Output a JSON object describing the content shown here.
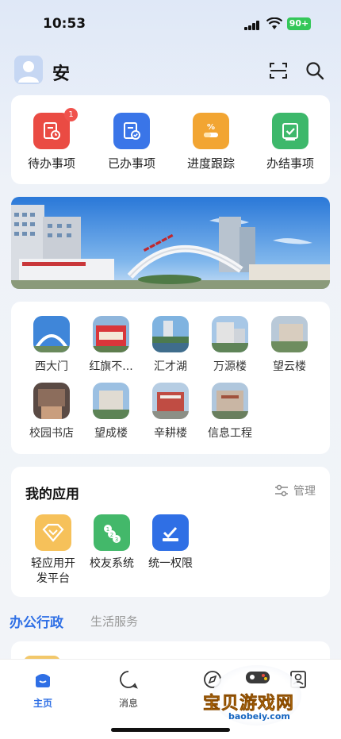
{
  "status_bar": {
    "time": "10:53",
    "battery": "90+"
  },
  "header": {
    "user_name": "安"
  },
  "quick_actions": [
    {
      "label": "待办事项",
      "badge": "1",
      "color": "#ea4b43",
      "icon": "pending-doc-icon"
    },
    {
      "label": "已办事项",
      "color": "#3a75e8",
      "icon": "done-doc-icon"
    },
    {
      "label": "进度跟踪",
      "color": "#f2a532",
      "icon": "progress-icon"
    },
    {
      "label": "办结事项",
      "color": "#3db86b",
      "icon": "finished-check-icon"
    }
  ],
  "places": [
    {
      "label": "西大门"
    },
    {
      "label": "红旗不..."
    },
    {
      "label": "汇才湖"
    },
    {
      "label": "万源楼"
    },
    {
      "label": "望云楼"
    },
    {
      "label": "校园书店"
    },
    {
      "label": "望成楼"
    },
    {
      "label": "辛耕楼"
    },
    {
      "label": "信息工程"
    }
  ],
  "my_apps": {
    "title": "我的应用",
    "manage_label": "管理",
    "apps": [
      {
        "label": "轻应用开发平台",
        "color": "#f6c15a",
        "icon": "diamond-icon"
      },
      {
        "label": "校友系统",
        "color": "#43b86a",
        "icon": "numbers-icon"
      },
      {
        "label": "统一权限",
        "color": "#2f6fe5",
        "icon": "permission-icon"
      }
    ]
  },
  "section_tabs": {
    "active": "办公行政",
    "other": "生活服务"
  },
  "bottom_nav": [
    {
      "label": "主页",
      "icon": "home-icon",
      "active": true
    },
    {
      "label": "消息",
      "icon": "message-icon"
    },
    {
      "label": "",
      "icon": "compass-icon"
    },
    {
      "label": "",
      "icon": "profile-icon"
    }
  ],
  "watermark": {
    "text": "宝贝游戏网",
    "url": "baobeiy.com"
  }
}
